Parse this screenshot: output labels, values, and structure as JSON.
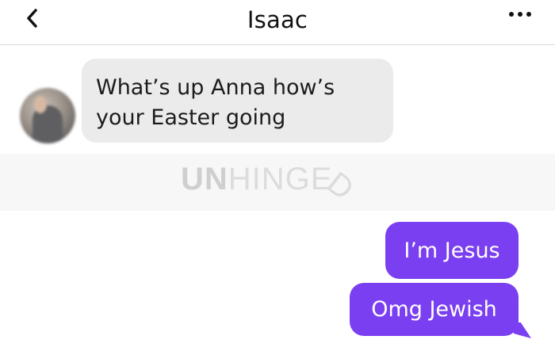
{
  "header": {
    "title": "Isaac",
    "back_icon": "chevron-left-icon",
    "more_icon": "more-horizontal-icon"
  },
  "messages": [
    {
      "direction": "incoming",
      "sender_avatar": "avatar",
      "text": "What’s up Anna how’s your Easter going"
    },
    {
      "direction": "outgoing",
      "text": "I’m Jesus"
    },
    {
      "direction": "outgoing",
      "text": "Omg Jewish"
    }
  ],
  "watermark": {
    "bold_part": "UN",
    "thin_part": "HINGE",
    "tilted_part": "D"
  },
  "colors": {
    "outgoing_bubble": "#7a3ff0",
    "incoming_bubble": "#ebebeb",
    "background": "#ffffff"
  }
}
